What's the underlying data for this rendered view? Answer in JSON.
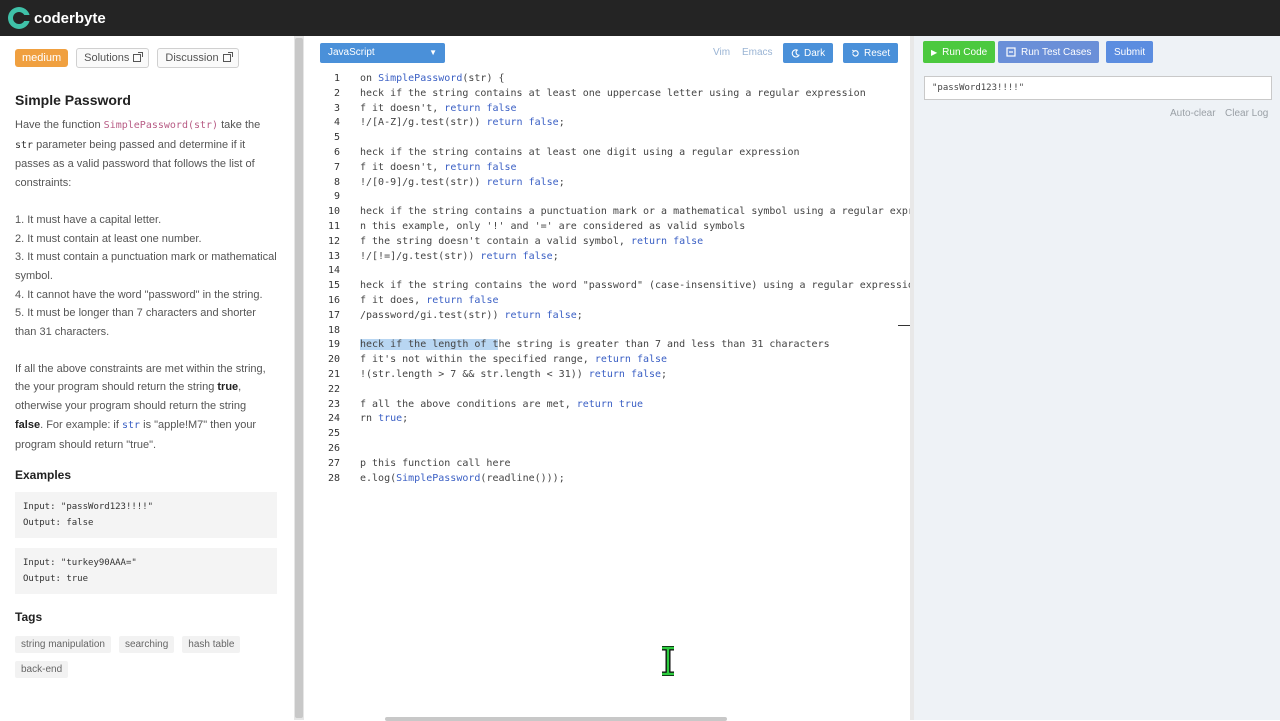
{
  "app": {
    "logo_text": "coderbyte"
  },
  "problem": {
    "difficulty": "medium",
    "solutions_label": "Solutions",
    "discussion_label": "Discussion",
    "title": "Simple Password",
    "intro_1": "Have the function ",
    "intro_fn": "SimplePassword(str)",
    "intro_2": " take the ",
    "intro_param": "str",
    "intro_3": " parameter being passed and determine if it passes as a valid password that follows the list of constraints:",
    "constraints": [
      "1. It must have a capital letter.",
      "2. It must contain at least one number.",
      "3. It must contain a punctuation mark or mathematical symbol.",
      "4. It cannot have the word \"password\" in the string.",
      "5. It must be longer than 7 characters and shorter than 31 characters."
    ],
    "outro_1": "If all the above constraints are met within the string, the your program should return the string ",
    "outro_true": "true",
    "outro_2": ", otherwise your program should return the string ",
    "outro_false": "false",
    "outro_3": ". For example: if ",
    "outro_str": "str",
    "outro_4": " is \"apple!M7\" then your program should return \"true\".",
    "examples_heading": "Examples",
    "examples": [
      {
        "input": "Input: \"passWord123!!!!\"",
        "output": "Output: false"
      },
      {
        "input": "Input: \"turkey90AAA=\"",
        "output": "Output: true"
      }
    ],
    "tags_heading": "Tags",
    "tags": [
      "string manipulation",
      "searching",
      "hash table",
      "back-end"
    ]
  },
  "editor": {
    "language": "JavaScript",
    "vim_label": "Vim",
    "emacs_label": "Emacs",
    "dark_label": "Dark",
    "reset_label": "Reset",
    "lines": [
      {
        "n": "1",
        "t": "on SimplePassword(str) {"
      },
      {
        "n": "2",
        "t": "heck if the string contains at least one uppercase letter using a regular expression"
      },
      {
        "n": "3",
        "t": "f it doesn't, return false"
      },
      {
        "n": "4",
        "t": "!/[A-Z]/g.test(str)) return false;"
      },
      {
        "n": "5",
        "t": ""
      },
      {
        "n": "6",
        "t": "heck if the string contains at least one digit using a regular expression"
      },
      {
        "n": "7",
        "t": "f it doesn't, return false"
      },
      {
        "n": "8",
        "t": "!/[0-9]/g.test(str)) return false;"
      },
      {
        "n": "9",
        "t": ""
      },
      {
        "n": "10",
        "t": "heck if the string contains a punctuation mark or a mathematical symbol using a regular expr"
      },
      {
        "n": "11",
        "t": "n this example, only '!' and '=' are considered as valid symbols"
      },
      {
        "n": "12",
        "t": "f the string doesn't contain a valid symbol, return false"
      },
      {
        "n": "13",
        "t": "!/[!=]/g.test(str)) return false;"
      },
      {
        "n": "14",
        "t": ""
      },
      {
        "n": "15",
        "t": "heck if the string contains the word \"password\" (case-insensitive) using a regular expressio"
      },
      {
        "n": "16",
        "t": "f it does, return false"
      },
      {
        "n": "17",
        "t": "/password/gi.test(str)) return false;"
      },
      {
        "n": "18",
        "t": ""
      },
      {
        "n": "19",
        "t": "heck if the length of the string is greater than 7 and less than 31 characters"
      },
      {
        "n": "20",
        "t": "f it's not within the specified range, return false"
      },
      {
        "n": "21",
        "t": "!(str.length > 7 && str.length < 31)) return false;"
      },
      {
        "n": "22",
        "t": ""
      },
      {
        "n": "23",
        "t": "f all the above conditions are met, return true"
      },
      {
        "n": "24",
        "t": "rn true;"
      },
      {
        "n": "25",
        "t": ""
      },
      {
        "n": "26",
        "t": ""
      },
      {
        "n": "27",
        "t": "p this function call here"
      },
      {
        "n": "28",
        "t": "e.log(SimplePassword(readline()));"
      }
    ]
  },
  "console": {
    "run_code_label": "Run Code",
    "run_tests_label": "Run Test Cases",
    "submit_label": "Submit",
    "input_value": "\"passWord123!!!!\"",
    "auto_clear_label": "Auto-clear",
    "clear_log_label": "Clear Log"
  },
  "colors": {
    "accent_blue": "#4a90d9",
    "run_green": "#4cc93f",
    "tests_blue": "#6a8fd8",
    "submit_blue": "#5b8de0",
    "difficulty_orange": "#f0a040"
  }
}
